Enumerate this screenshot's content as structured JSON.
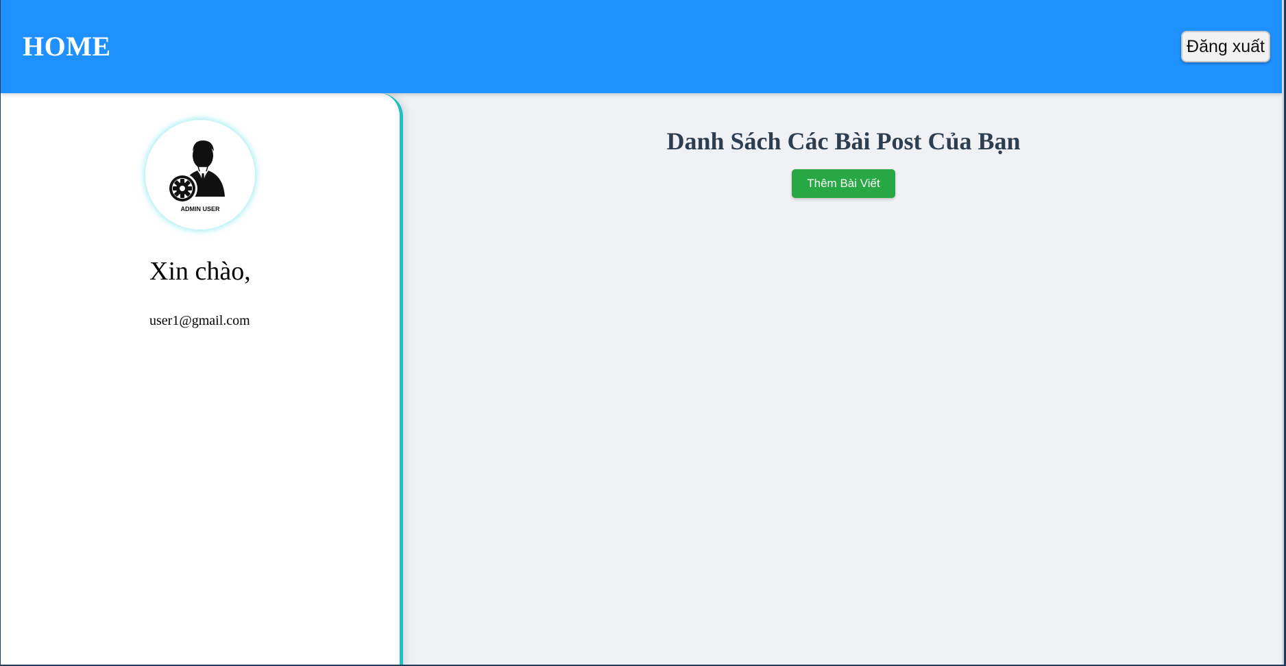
{
  "header": {
    "title": "HOME",
    "logout_label": "Đăng xuất",
    "background_color": "#1e90ff"
  },
  "sidebar": {
    "avatar": {
      "icon": "admin-user-icon",
      "caption": "ADMIN USER"
    },
    "greeting": "Xin chào,",
    "email": "user1@gmail.com",
    "accent_color": "#1fbfc5"
  },
  "main": {
    "title": "Danh Sách Các Bài Post Của Bạn",
    "add_post_label": "Thêm Bài Viết",
    "add_post_color": "#28a745",
    "background_color": "#eff1f5"
  }
}
